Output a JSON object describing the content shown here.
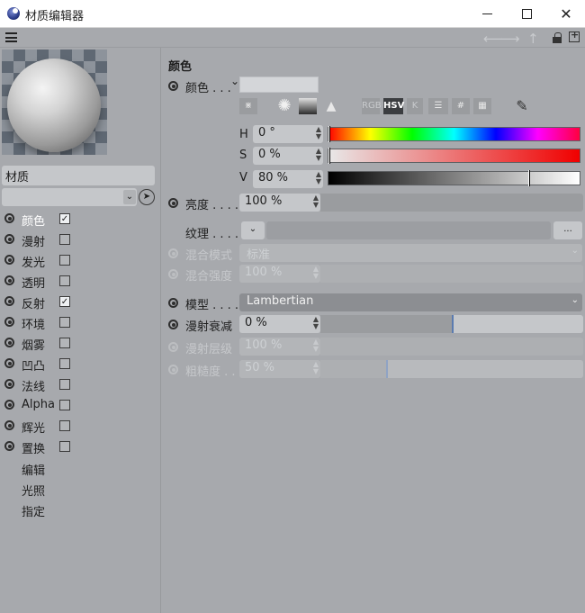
{
  "window": {
    "title": "材质编辑器",
    "minimize": "—",
    "close": "✕"
  },
  "toolbar": {
    "back_icon": "arrow-left-icon",
    "forward_icon": "arrow-right-icon",
    "up_icon": "arrow-up-icon",
    "lock_icon": "lock-icon",
    "new_window_icon": "new-window-icon"
  },
  "left_panel": {
    "material_name": "材质",
    "channels": [
      {
        "label": "颜色",
        "checked": true,
        "check": "✓"
      },
      {
        "label": "漫射",
        "checked": false,
        "check": ""
      },
      {
        "label": "发光",
        "checked": false,
        "check": ""
      },
      {
        "label": "透明",
        "checked": false,
        "check": ""
      },
      {
        "label": "反射",
        "checked": true,
        "check": "✓"
      },
      {
        "label": "环境",
        "checked": false,
        "check": ""
      },
      {
        "label": "烟雾",
        "checked": false,
        "check": ""
      },
      {
        "label": "凹凸",
        "checked": false,
        "check": ""
      },
      {
        "label": "法线",
        "checked": false,
        "check": ""
      },
      {
        "label": "Alpha",
        "checked": false,
        "check": ""
      },
      {
        "label": "辉光",
        "checked": false,
        "check": ""
      },
      {
        "label": "置换",
        "checked": false,
        "check": ""
      }
    ],
    "extra_items": [
      "编辑",
      "光照",
      "指定"
    ]
  },
  "color_section": {
    "title": "颜色",
    "color_label": "颜色 . . .",
    "color_chevron": "⌄",
    "tools": [
      "RGB",
      "HSV",
      "K",
      "#"
    ],
    "h": {
      "label": "H",
      "value": "0 °",
      "fraction": 0.0
    },
    "s": {
      "label": "S",
      "value": "0 %",
      "fraction": 0.0
    },
    "v": {
      "label": "V",
      "value": "80 %",
      "fraction": 0.8
    },
    "brightness": {
      "label": "亮度 . . . .",
      "value": "100 %",
      "fraction": 1.0
    },
    "texture": {
      "label": "纹理 . . . .",
      "more": "..."
    },
    "blend_mode": {
      "label": "混合模式",
      "value": "标准"
    },
    "blend_strength": {
      "label": "混合强度",
      "value": "100 %"
    }
  },
  "shading": {
    "model": {
      "label": "模型 . . . .",
      "value": "Lambertian"
    },
    "diffuse_falloff": {
      "label": "漫射衰减",
      "value": "0 %",
      "fraction": 0.5
    },
    "diffuse_level": {
      "label": "漫射层级",
      "value": "100 %"
    },
    "roughness": {
      "label": "粗糙度 . .",
      "value": "50 %",
      "fraction": 0.25
    }
  },
  "colors": {
    "bg": "#a7a9ad",
    "field": "#c5c7ca",
    "accent": "#5b7bb0"
  }
}
